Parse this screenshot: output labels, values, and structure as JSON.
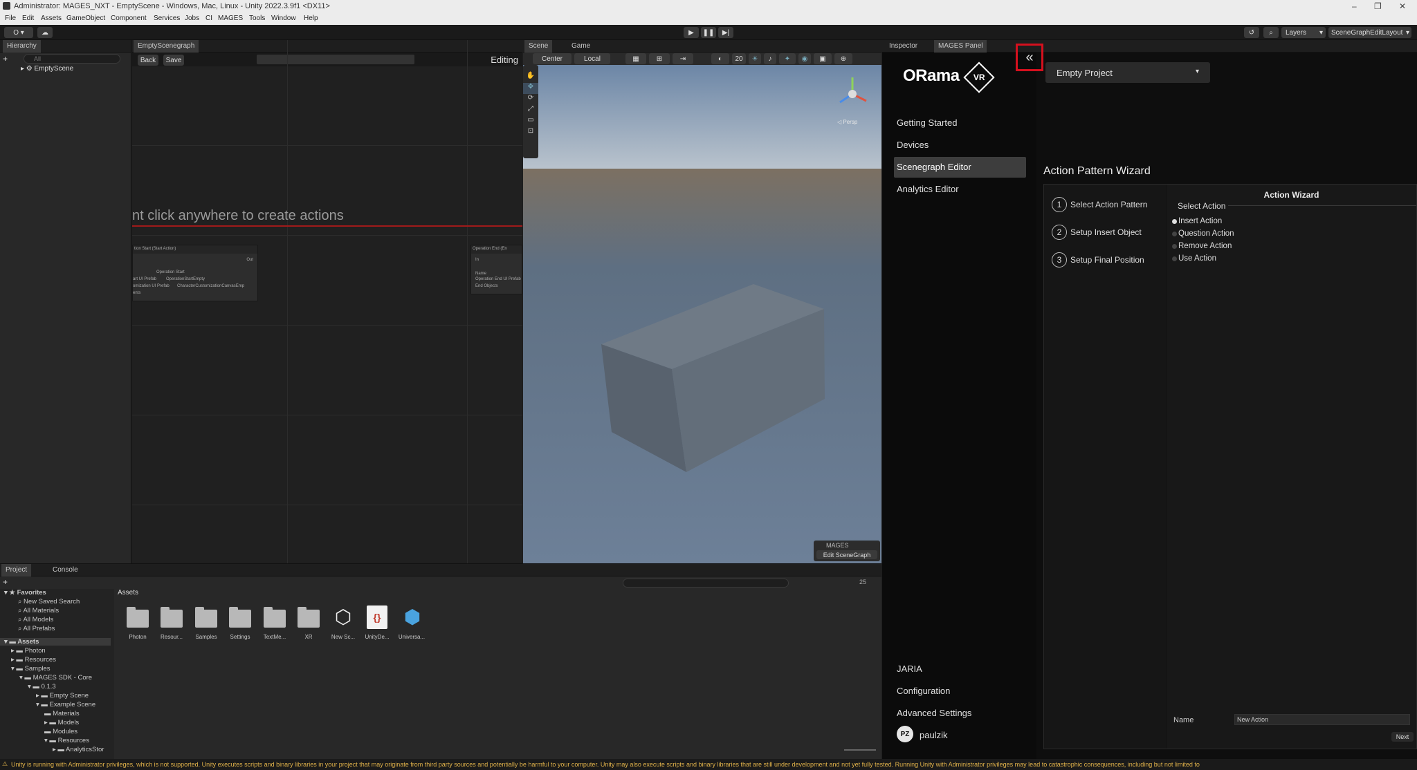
{
  "window": {
    "title": "Administrator: MAGES_NXT - EmptyScene - Windows, Mac, Linux - Unity 2022.3.9f1 <DX11>"
  },
  "menu": [
    "File",
    "Edit",
    "Assets",
    "GameObject",
    "Component",
    "Services",
    "Jobs",
    "CI",
    "MAGES",
    "Tools",
    "Window",
    "Help"
  ],
  "toolbar": {
    "account": "O ▾",
    "layers": "Layers",
    "layout": "SceneGraphEditLayout"
  },
  "hierarchy": {
    "tab": "Hierarchy",
    "search_placeholder": "All",
    "root": "EmptyScene"
  },
  "scenegraph": {
    "tab": "EmptyScenegraph",
    "back": "Back",
    "save": "Save",
    "mode": "Editing",
    "hint": "nt click anywhere to create actions",
    "node_start": {
      "title": "tion Start (Start Action)",
      "out": "Out",
      "header": "Operation Start",
      "row1_label": "art UI Prefab",
      "row1_value": "OperationStartEmpty",
      "row2_label": "omization UI Prefab",
      "row2_value": "CharacterCustomizationCanvasEmp",
      "row3_label": "ents"
    },
    "node_end": {
      "title": "Operation End (En",
      "in": "In",
      "row1": "Name",
      "row2": "Operation End UI Prefab",
      "row3": "End Objects"
    }
  },
  "scene": {
    "tabs": [
      "Scene",
      "Game"
    ],
    "pivot": "Center",
    "space": "Local",
    "grid_size": "20",
    "persp": "◁ Persp",
    "mages_label": "MAGES",
    "edit_scenegraph": "Edit SceneGraph"
  },
  "inspector": {
    "tabs": [
      "Inspector",
      "MAGES Panel"
    ]
  },
  "orama": {
    "logo": "ORama",
    "logo_badge": "VR",
    "collapse_icon": "«",
    "project_select": "Empty Project",
    "nav": [
      "Getting Started",
      "Devices",
      "Scenegraph Editor",
      "Analytics Editor"
    ],
    "nav_active": 2,
    "bottom_nav": [
      "JARIA",
      "Configuration",
      "Advanced Settings"
    ],
    "user_initials": "PZ",
    "user_name": "paulzik",
    "wizard_title": "Action Pattern Wizard",
    "steps": [
      {
        "num": "1",
        "label": "Select Action Pattern"
      },
      {
        "num": "2",
        "label": "Setup Insert Object"
      },
      {
        "num": "3",
        "label": "Setup Final Position"
      }
    ],
    "action_wizard_header": "Action Wizard",
    "select_action_label": "Select Action",
    "actions": [
      "Insert Action",
      "Question Action",
      "Remove Action",
      "Use Action"
    ],
    "selected_action": 0,
    "name_label": "Name",
    "name_value": "New Action",
    "next": "Next"
  },
  "project": {
    "tabs": [
      "Project",
      "Console"
    ],
    "count_badge": "25",
    "favorites": [
      "Favorites",
      "New Saved Search",
      "All Materials",
      "All Models",
      "All Prefabs"
    ],
    "tree": [
      "Assets",
      "Photon",
      "Resources",
      "Samples",
      "MAGES SDK - Core",
      "0.1.3",
      "Empty Scene",
      "Example Scene",
      "Materials",
      "Models",
      "Modules",
      "Resources",
      "AnalyticsStor"
    ],
    "breadcrumb": "Assets",
    "assets": [
      "Photon",
      "Resour...",
      "Samples",
      "Settings",
      "TextMe...",
      "XR",
      "New Sc...",
      "UnityDe...",
      "Universa..."
    ]
  },
  "status": "Unity is running with Administrator privileges, which is not supported. Unity executes scripts and binary libraries in your project that may originate from third party sources and potentially be harmful to your computer. Unity may also execute scripts and binary libraries that are still under development and not yet fully tested. Running Unity with Administrator privileges may lead to catastrophic consequences, including but not limited to"
}
